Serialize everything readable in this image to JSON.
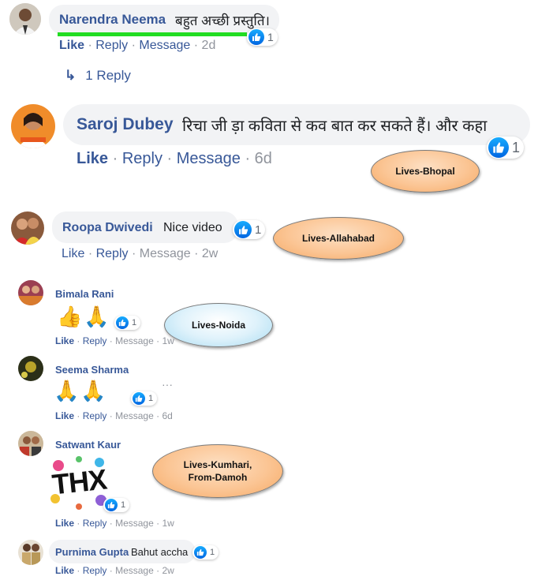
{
  "comments": [
    {
      "name": "Narendra Neema",
      "text": "बहुत अच्छी प्रस्तुति।",
      "like": "Like",
      "reply": "Reply",
      "message": "Message",
      "time": "2d",
      "reactions": "1"
    },
    {
      "name": "Saroj Dubey",
      "text": "रिचा जी ड़ा कविता से कव बात कर सकते हैं। और कहा",
      "like": "Like",
      "reply": "Reply",
      "message": "Message",
      "time": "6d",
      "reactions": "1"
    },
    {
      "name": "Roopa Dwivedi",
      "text": "Nice video",
      "like": "Like",
      "reply": "Reply",
      "message": "Message",
      "time": "2w",
      "reactions": "1"
    },
    {
      "name": "Bimala Rani",
      "emojis": "👍🙏",
      "like": "Like",
      "reply": "Reply",
      "message": "Message",
      "time": "1w",
      "reactions": "1"
    },
    {
      "name": "Seema Sharma",
      "emojis": "🙏🙏",
      "like": "Like",
      "reply": "Reply",
      "message": "Message",
      "time": "6d",
      "reactions": "1",
      "more": "···"
    },
    {
      "name": "Satwant Kaur",
      "sticker": "THX",
      "like": "Like",
      "reply": "Reply",
      "message": "Message",
      "time": "1w",
      "reactions": "1"
    },
    {
      "name": "Purnima Gupta",
      "text": "Bahut accha",
      "like": "Like",
      "reply": "Reply",
      "message": "Message",
      "time": "2w",
      "reactions": "1"
    }
  ],
  "replies_link": {
    "icon": "↳",
    "text": "1 Reply"
  },
  "annotations": [
    {
      "text": "Lives-Bhopal"
    },
    {
      "text": "Lives-Allahabad"
    },
    {
      "text": "Lives-Noida"
    },
    {
      "text": "Lives-Kumhari, From-Damoh"
    }
  ],
  "colors": {
    "link": "#385898",
    "meta": "#90949c",
    "bubble": "#f2f3f5",
    "highlight_line": "#22dd22",
    "like_blue": "#0165e1"
  }
}
